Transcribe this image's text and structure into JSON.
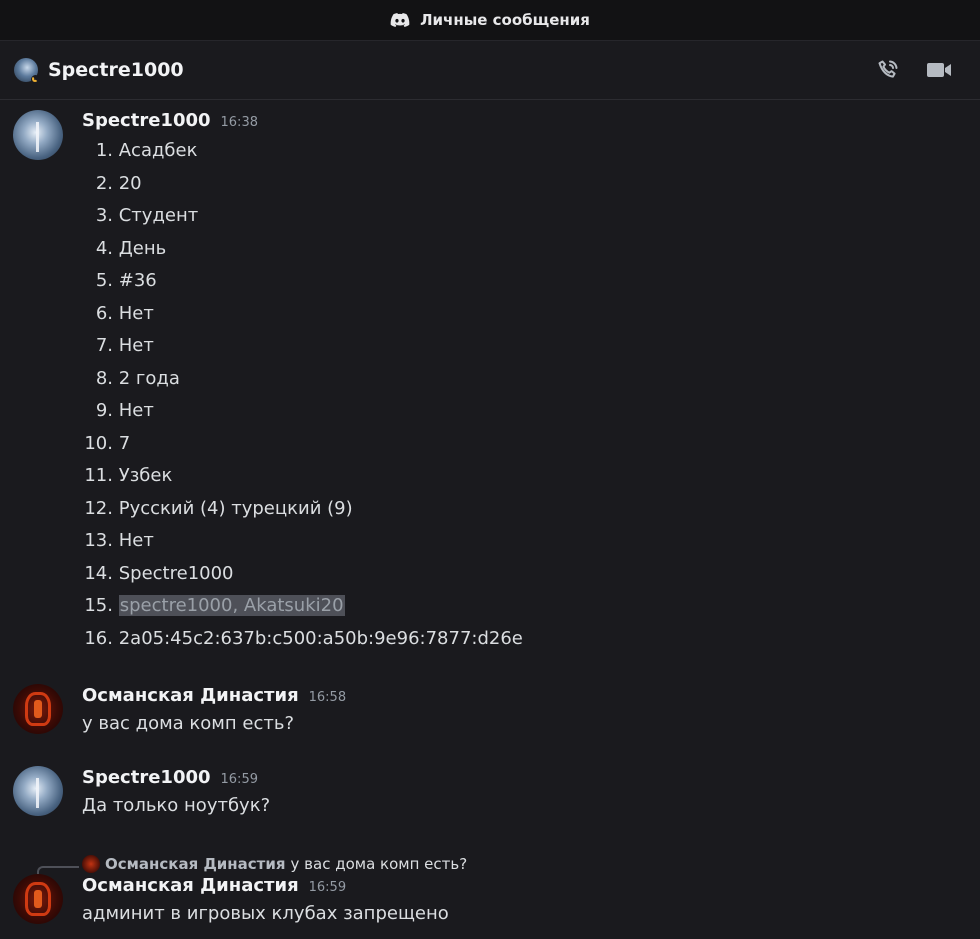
{
  "window": {
    "title": "Личные сообщения",
    "logo_icon": "discord-logo-icon"
  },
  "header": {
    "name": "Spectre1000",
    "status": "idle",
    "icons": [
      "voice-call-icon",
      "video-call-icon"
    ]
  },
  "messages": [
    {
      "author": "Spectre1000",
      "time": "16:38",
      "avatar": "spectre-avatar",
      "items": [
        {
          "n": "1.",
          "text": "Асадбек"
        },
        {
          "n": "2.",
          "text": "20"
        },
        {
          "n": "3.",
          "text": "Студент"
        },
        {
          "n": "4.",
          "text": "День"
        },
        {
          "n": "5.",
          "text": "#36"
        },
        {
          "n": "6.",
          "text": "Нет"
        },
        {
          "n": "7.",
          "text": "Нет"
        },
        {
          "n": "8.",
          "text": "2 года"
        },
        {
          "n": "9.",
          "text": "Нет"
        },
        {
          "n": "10.",
          "text": "7"
        },
        {
          "n": "11.",
          "text": "Узбек"
        },
        {
          "n": "12.",
          "text": "Русский (4) турецкий (9)"
        },
        {
          "n": "13.",
          "text": "Нет"
        },
        {
          "n": "14.",
          "text": "Spectre1000"
        },
        {
          "n": "15.",
          "text": "spectre1000, Akatsuki20",
          "spoiler": true
        },
        {
          "n": "16.",
          "text": "2a05:45c2:637b:c500:a50b:9e96:7877:d26e"
        }
      ]
    },
    {
      "author": "Османская Династия",
      "time": "16:58",
      "text": "у вас дома комп есть?"
    },
    {
      "author": "Spectre1000",
      "time": "16:59",
      "text": "Да только ноутбук?"
    },
    {
      "author": "Османская Династия",
      "time": "16:59",
      "text": "админит в игровых клубах запрещено",
      "reply": {
        "author": "Османская Династия",
        "text": "у вас дома комп есть?"
      }
    }
  ]
}
